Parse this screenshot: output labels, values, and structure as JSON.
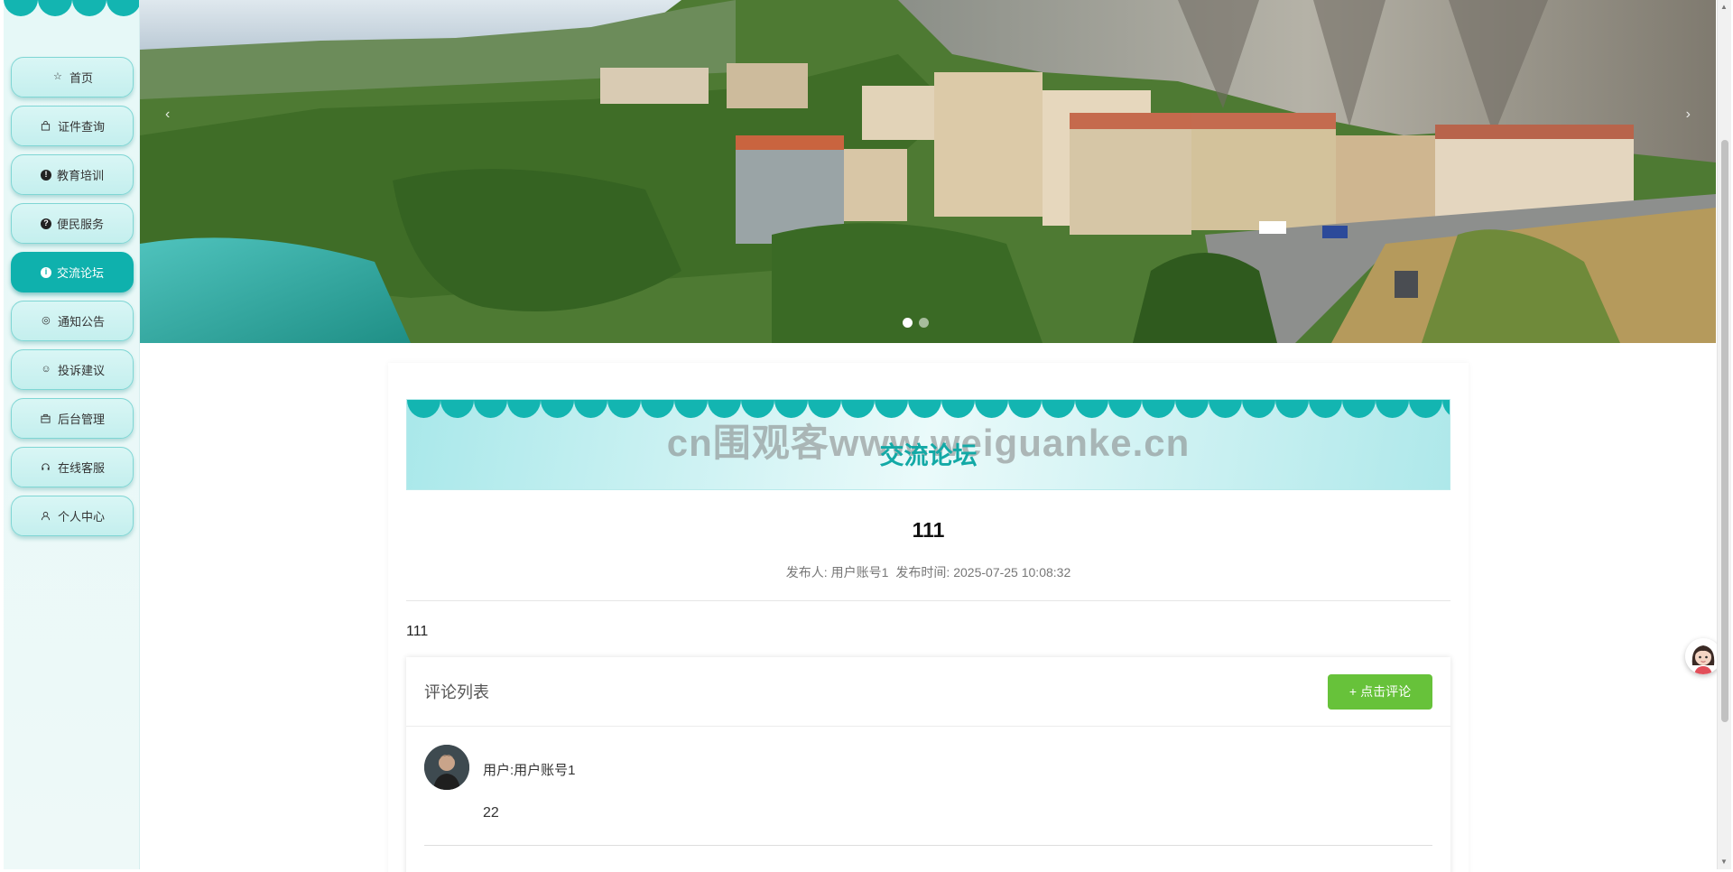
{
  "sidebar": {
    "items": [
      {
        "label": "首页",
        "icon": "star-icon",
        "active": false
      },
      {
        "label": "证件查询",
        "icon": "bag-icon",
        "active": false
      },
      {
        "label": "教育培训",
        "icon": "alert-circle-icon",
        "active": false
      },
      {
        "label": "便民服务",
        "icon": "question-circle-icon",
        "active": false
      },
      {
        "label": "交流论坛",
        "icon": "info-circle-icon",
        "active": true
      },
      {
        "label": "通知公告",
        "icon": "target-icon",
        "active": false
      },
      {
        "label": "投诉建议",
        "icon": "smile-icon",
        "active": false
      },
      {
        "label": "后台管理",
        "icon": "briefcase-icon",
        "active": false
      },
      {
        "label": "在线客服",
        "icon": "headset-icon",
        "active": false
      },
      {
        "label": "个人中心",
        "icon": "user-icon",
        "active": false
      }
    ]
  },
  "banner": {
    "prev_arrow": "‹",
    "next_arrow": "›",
    "slide_count": 2,
    "active_slide": 1
  },
  "section": {
    "watermark": "cn围观客www.weiguanke.cn",
    "title": "交流论坛"
  },
  "post": {
    "title": "111",
    "author_label": "发布人:",
    "author": "用户账号1",
    "time_label": "发布时间:",
    "time": "2025-07-25 10:08:32",
    "content": "111"
  },
  "comments": {
    "title": "评论列表",
    "button_icon": "+",
    "button_label": "点击评论",
    "items": [
      {
        "user_label": "用户:",
        "user": "用户账号1",
        "text": "22"
      }
    ]
  },
  "colors": {
    "accent": "#0fb1ad",
    "button_green": "#67c23a",
    "nav_bg": "#c9f0ef"
  }
}
